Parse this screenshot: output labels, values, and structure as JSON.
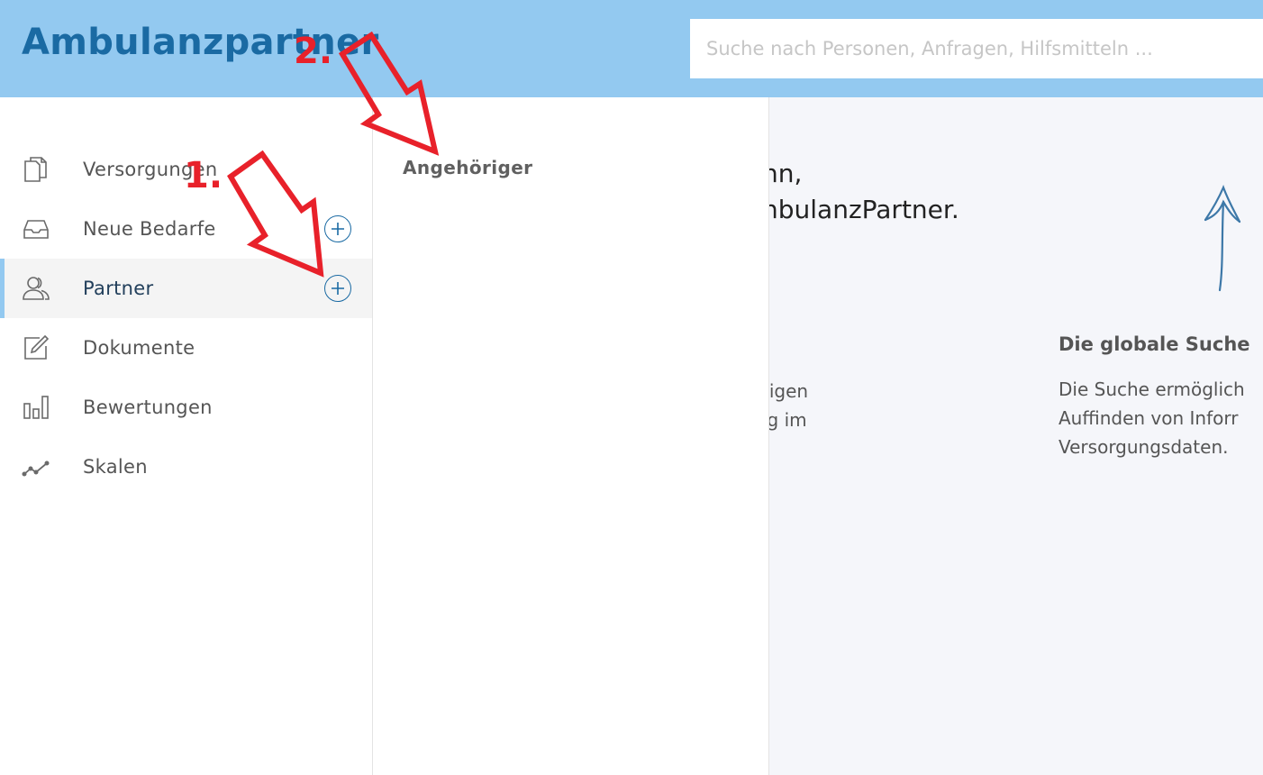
{
  "header": {
    "brand": "Ambulanzpartner",
    "search_placeholder": "Suche nach Personen, Anfragen, Hilfsmitteln ..."
  },
  "sidebar": {
    "items": [
      {
        "label": "Versorgungen",
        "icon": "documents-icon",
        "has_add": false
      },
      {
        "label": "Neue Bedarfe",
        "icon": "inbox-tray-icon",
        "has_add": true
      },
      {
        "label": "Partner",
        "icon": "users-icon",
        "has_add": true,
        "active": true
      },
      {
        "label": "Dokumente",
        "icon": "edit-icon",
        "has_add": false
      },
      {
        "label": "Bewertungen",
        "icon": "bar-chart-icon",
        "has_add": false
      },
      {
        "label": "Skalen",
        "icon": "line-chart-icon",
        "has_add": false
      }
    ]
  },
  "submenu": {
    "items": [
      "Angehöriger"
    ]
  },
  "main": {
    "greeting_line1": "nn,",
    "greeting_line2": "nbulanzPartner.",
    "left_paragraph": [
      "tigen",
      "ıg im"
    ],
    "feature_title": "Die globale Suche",
    "feature_text": [
      "Die Suche ermöglich",
      "Auffinden von Inforr",
      "Versorgungsdaten."
    ]
  },
  "annotations": {
    "step1": "1.",
    "step2": "2."
  },
  "colors": {
    "header_bg": "#93c9f0",
    "brand": "#1a6aa3",
    "annotation": "#e8212a",
    "active_accent": "#93c9f0"
  }
}
